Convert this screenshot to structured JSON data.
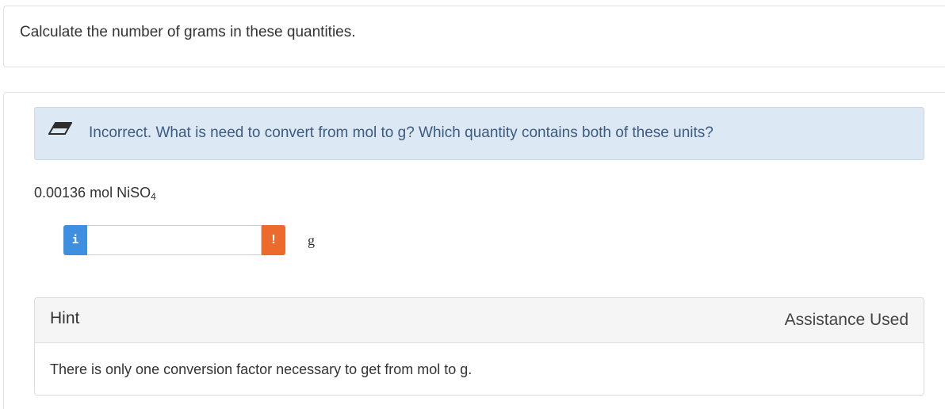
{
  "question": {
    "prompt": "Calculate the number of grams in these quantities."
  },
  "feedback": {
    "icon": "eraser-icon",
    "message": "Incorrect. What is need to convert from mol to g? Which quantity contains both of these units?"
  },
  "problem": {
    "quantity_value": "0.00136 mol NiSO",
    "quantity_subscript": "4",
    "answer_value": "",
    "info_button_label": "i",
    "warning_button_label": "!",
    "unit": "g"
  },
  "hint": {
    "title": "Hint",
    "status": "Assistance Used",
    "body": "There is only one conversion factor necessary to get from mol to g."
  },
  "colors": {
    "alert_background": "#dce9f5",
    "alert_text": "#3d5a80",
    "info_button": "#3f8fe0",
    "warning_button": "#ec6a2c"
  }
}
